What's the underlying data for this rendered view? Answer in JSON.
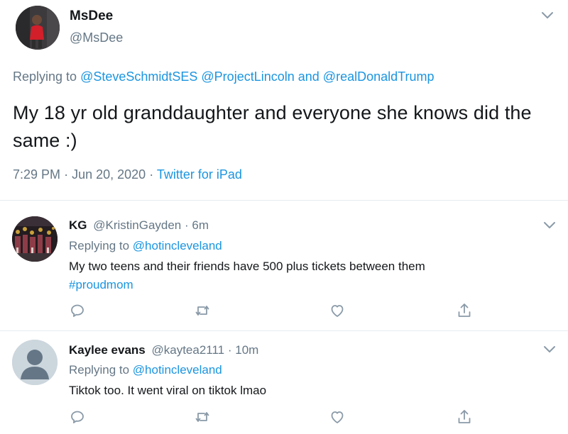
{
  "main_tweet": {
    "display_name": "MsDee",
    "handle": "@MsDee",
    "replying_prefix": "Replying to",
    "replying_mentions": [
      "@SteveSchmidtSES",
      "@ProjectLincoln"
    ],
    "replying_and": "and",
    "replying_last": "@realDonaldTrump",
    "text": "My 18 yr old granddaughter and everyone she knows did the same :)",
    "time": "7:29 PM",
    "date": "Jun 20, 2020",
    "source": "Twitter for iPad",
    "separator": "·",
    "menu_icon": "chevron-down-icon"
  },
  "replies": [
    {
      "display_name": "KG",
      "handle": "@KristinGayden",
      "separator": "·",
      "age": "6m",
      "replying_prefix": "Replying to",
      "replying_to": "@hotincleveland",
      "text": "My two teens and their friends have 500 plus tickets between them",
      "hashtag": "#proudmom"
    },
    {
      "display_name": "Kaylee evans",
      "handle": "@kaytea2111",
      "separator": "·",
      "age": "10m",
      "replying_prefix": "Replying to",
      "replying_to": "@hotincleveland",
      "text": "Tiktok too. It went viral on tiktok lmao",
      "hashtag": ""
    }
  ],
  "actions": [
    "reply-icon",
    "retweet-icon",
    "like-icon",
    "share-icon"
  ],
  "colors": {
    "link": "#1b95e0",
    "secondary_text": "#657786",
    "primary_text": "#14171a",
    "divider": "#e6ecf0",
    "action_icon": "#8a9aa8"
  }
}
